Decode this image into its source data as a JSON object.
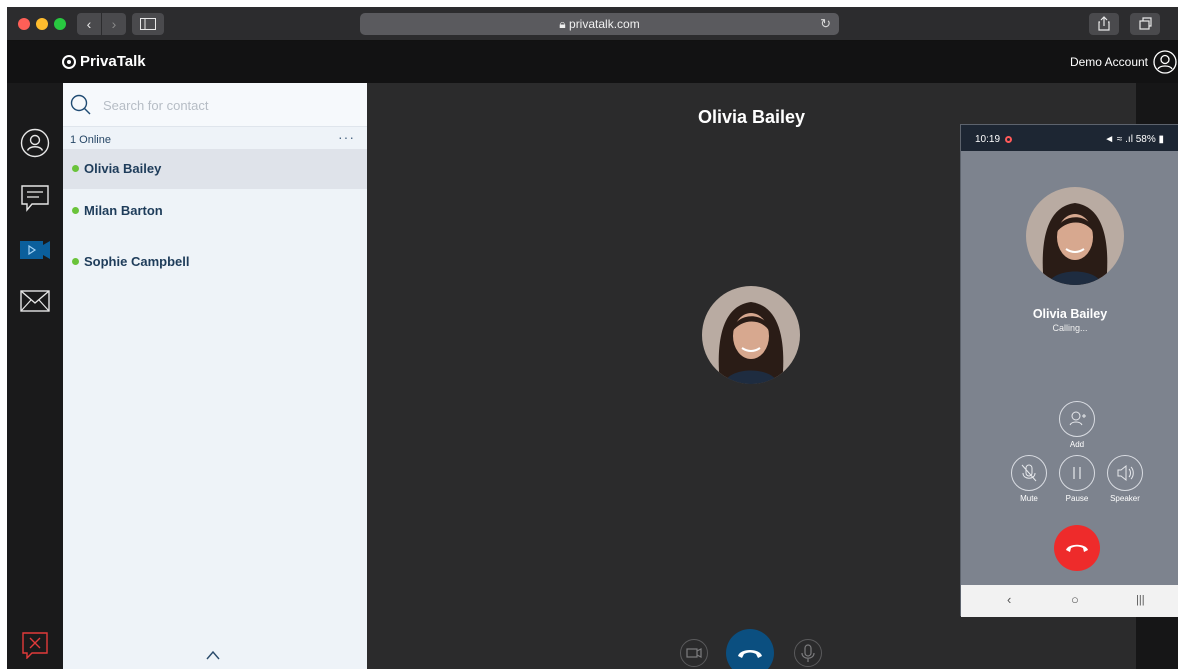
{
  "browser": {
    "url": "privatalk.com",
    "lock_icon": "lock-icon",
    "reload_icon": "↻",
    "back_icon": "‹",
    "forward_icon": "›"
  },
  "app": {
    "brand": "PrivaTalk",
    "account": "Demo Account"
  },
  "contacts": {
    "search_placeholder": "Search for contact",
    "online_count": "1 Online",
    "more": "···",
    "items": [
      {
        "name": "Olivia Bailey",
        "status": "online",
        "selected": true
      },
      {
        "name": "Milan Barton",
        "status": "online",
        "selected": false
      },
      {
        "name": "Sophie Campbell",
        "status": "online",
        "selected": false
      }
    ]
  },
  "call": {
    "callee": "Olivia Bailey"
  },
  "phone": {
    "time": "10:19",
    "battery": "58%",
    "signal_text": "ɴ ⁺ .ıl 58% ▮",
    "name": "Olivia Bailey",
    "status": "Calling...",
    "controls": {
      "add": "Add",
      "mute": "Mute",
      "pause": "Pause",
      "speaker": "Speaker"
    },
    "nav": {
      "back": "‹",
      "home": "○",
      "recent": "|||"
    }
  },
  "colors": {
    "accent": "#0b4f80",
    "online": "#6ac33a",
    "end_call": "#ee2b2b"
  }
}
